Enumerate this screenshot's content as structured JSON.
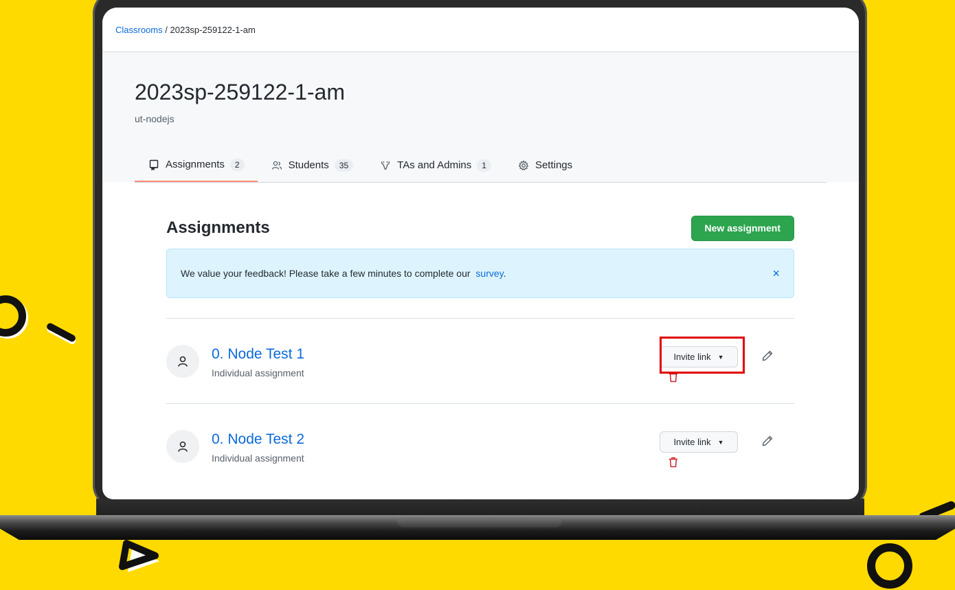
{
  "breadcrumb": {
    "root": "Classrooms",
    "separator": "/",
    "current": "2023sp-259122-1-am"
  },
  "classroom": {
    "title": "2023sp-259122-1-am",
    "organization": "ut-nodejs"
  },
  "tabs": [
    {
      "label": "Assignments",
      "count": "2",
      "icon": "repo-icon",
      "active": true
    },
    {
      "label": "Students",
      "count": "35",
      "icon": "people-icon",
      "active": false
    },
    {
      "label": "TAs and Admins",
      "count": "1",
      "icon": "tools-icon",
      "active": false
    },
    {
      "label": "Settings",
      "icon": "gear-icon",
      "active": false
    }
  ],
  "main": {
    "section_title": "Assignments",
    "new_button_label": "New assignment"
  },
  "flash": {
    "message": "We value your feedback! Please take a few minutes to complete our",
    "link_text": "survey",
    "end": ".",
    "close_glyph": "×"
  },
  "assignments": [
    {
      "title": "0. Node Test 1",
      "type": "Individual assignment",
      "invite_label": "Invite link"
    },
    {
      "title": "0. Node Test 2",
      "type": "Individual assignment",
      "invite_label": "Invite link"
    }
  ],
  "colors": {
    "background": "#FFDA00",
    "link": "#0969da",
    "primary_button": "#2da44e",
    "highlight": "#e00000",
    "danger": "#cf222e"
  }
}
